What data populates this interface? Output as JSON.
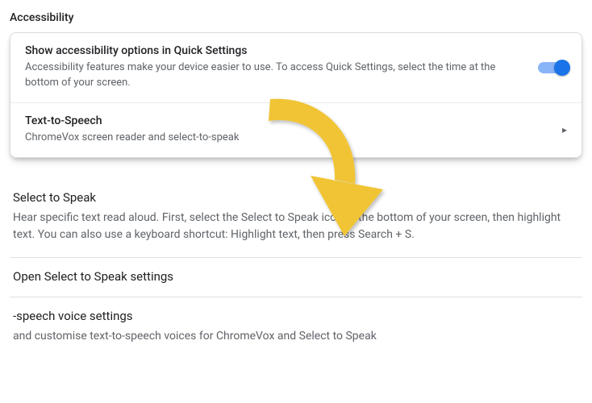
{
  "header": {
    "title": "Accessibility"
  },
  "card": {
    "quick": {
      "title": "Show accessibility options in Quick Settings",
      "desc": "Accessibility features make your device easier to use. To access Quick Settings, select the time at the bottom of your screen.",
      "toggle_on": true
    },
    "tts": {
      "title": "Text-to-Speech",
      "desc": "ChromeVox screen reader and select-to-speak"
    }
  },
  "select_to_speak": {
    "title": "Select to Speak",
    "desc": "Hear specific text read aloud. First, select the Select to Speak icon at the bottom of your screen, then highlight text. You can also use a keyboard shortcut: Highlight text, then press Search + S."
  },
  "open_link": {
    "title": "Open Select to Speak settings"
  },
  "voice": {
    "title_cut": "-speech voice settings",
    "desc_cut": "and customise text-to-speech voices for ChromeVox and Select to Speak"
  },
  "annotation": {
    "arrow_color": "#f0c434"
  }
}
